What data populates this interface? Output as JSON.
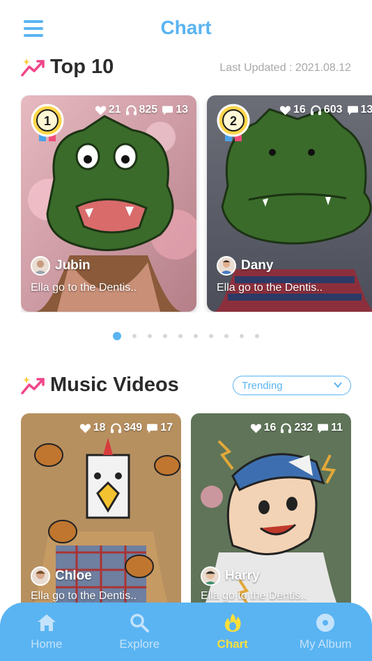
{
  "header": {
    "title": "Chart"
  },
  "top10": {
    "title": "Top 10",
    "last_updated": "Last Updated : 2021.08.12",
    "cards": [
      {
        "rank": "1",
        "likes": "21",
        "listens": "825",
        "comments": "13",
        "author": "Jubin",
        "song": "Ella go to the Dentis.."
      },
      {
        "rank": "2",
        "likes": "16",
        "listens": "603",
        "comments": "13",
        "author": "Dany",
        "song": "Ella go to the Dentis.."
      }
    ],
    "pager": {
      "total": 10,
      "active": 1
    }
  },
  "music_videos": {
    "title": "Music Videos",
    "filter": "Trending",
    "cards": [
      {
        "likes": "18",
        "listens": "349",
        "comments": "17",
        "author": "Chloe",
        "song": "Ella go to the Dentis.."
      },
      {
        "likes": "16",
        "listens": "232",
        "comments": "11",
        "author": "Harry",
        "song": "Ella go to the Dentis.."
      }
    ]
  },
  "tabbar": {
    "tabs": [
      {
        "label": "Home",
        "icon": "home-icon"
      },
      {
        "label": "Explore",
        "icon": "search-icon"
      },
      {
        "label": "Chart",
        "icon": "flame-icon",
        "active": true
      },
      {
        "label": "My Album",
        "icon": "disc-icon"
      }
    ]
  },
  "colors": {
    "accent": "#5ab4f2",
    "active_tab": "#ffdf3a",
    "muted": "#a8a8a8"
  }
}
